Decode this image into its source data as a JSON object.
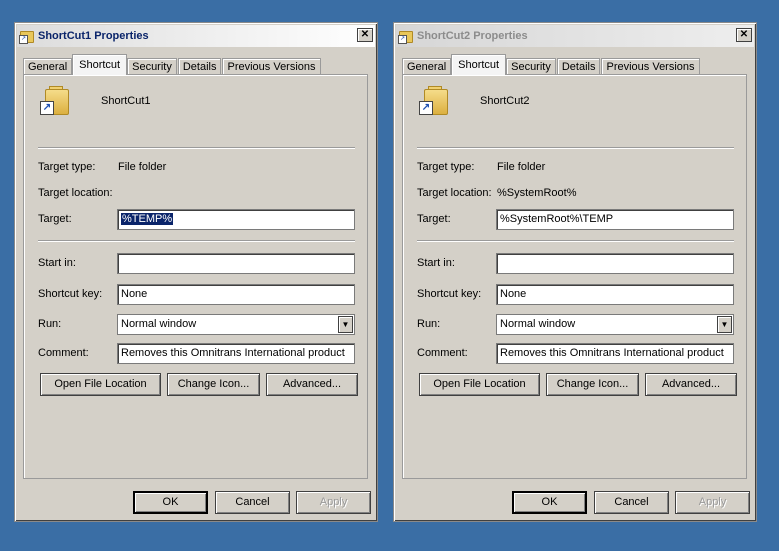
{
  "windows": [
    {
      "title": "ShortCut1 Properties",
      "close_glyph": "✕",
      "tabs": [
        "General",
        "Shortcut",
        "Security",
        "Details",
        "Previous Versions"
      ],
      "active_tab": "Shortcut",
      "shortcut_name": "ShortCut1",
      "target_type_label": "Target type:",
      "target_type_value": "File folder",
      "target_location_label": "Target location:",
      "target_location_value": "",
      "target_label": "Target:",
      "target_value": "%TEMP%",
      "start_in_label": "Start in:",
      "start_in_value": "",
      "shortcut_key_label": "Shortcut key:",
      "shortcut_key_value": "None",
      "run_label": "Run:",
      "run_value": "Normal window",
      "comment_label": "Comment:",
      "comment_value": "Removes this Omnitrans International product",
      "open_location_label": "Open File Location",
      "change_icon_label": "Change Icon...",
      "advanced_label": "Advanced...",
      "ok_label": "OK",
      "cancel_label": "Cancel",
      "apply_label": "Apply"
    },
    {
      "title": "ShortCut2 Properties",
      "close_glyph": "✕",
      "tabs": [
        "General",
        "Shortcut",
        "Security",
        "Details",
        "Previous Versions"
      ],
      "active_tab": "Shortcut",
      "shortcut_name": "ShortCut2",
      "target_type_label": "Target type:",
      "target_type_value": "File folder",
      "target_location_label": "Target location:",
      "target_location_value": "%SystemRoot%",
      "target_label": "Target:",
      "target_value": "%SystemRoot%\\TEMP",
      "start_in_label": "Start in:",
      "start_in_value": "",
      "shortcut_key_label": "Shortcut key:",
      "shortcut_key_value": "None",
      "run_label": "Run:",
      "run_value": "Normal window",
      "comment_label": "Comment:",
      "comment_value": "Removes this Omnitrans International product",
      "open_location_label": "Open File Location",
      "change_icon_label": "Change Icon...",
      "advanced_label": "Advanced...",
      "ok_label": "OK",
      "cancel_label": "Cancel",
      "apply_label": "Apply"
    }
  ],
  "icons": {
    "title_icon": "folder-shortcut-icon",
    "shortcut_icon": "folder-shortcut-icon",
    "close": "close-icon",
    "dropdown": "chevron-down-icon"
  },
  "colors": {
    "desktop": "#3a6ea5",
    "dialog": "#d4d0c8",
    "selection": "#0a246a",
    "active_title_text": "#0a246a",
    "inactive_title_text": "#8c8c8c"
  }
}
